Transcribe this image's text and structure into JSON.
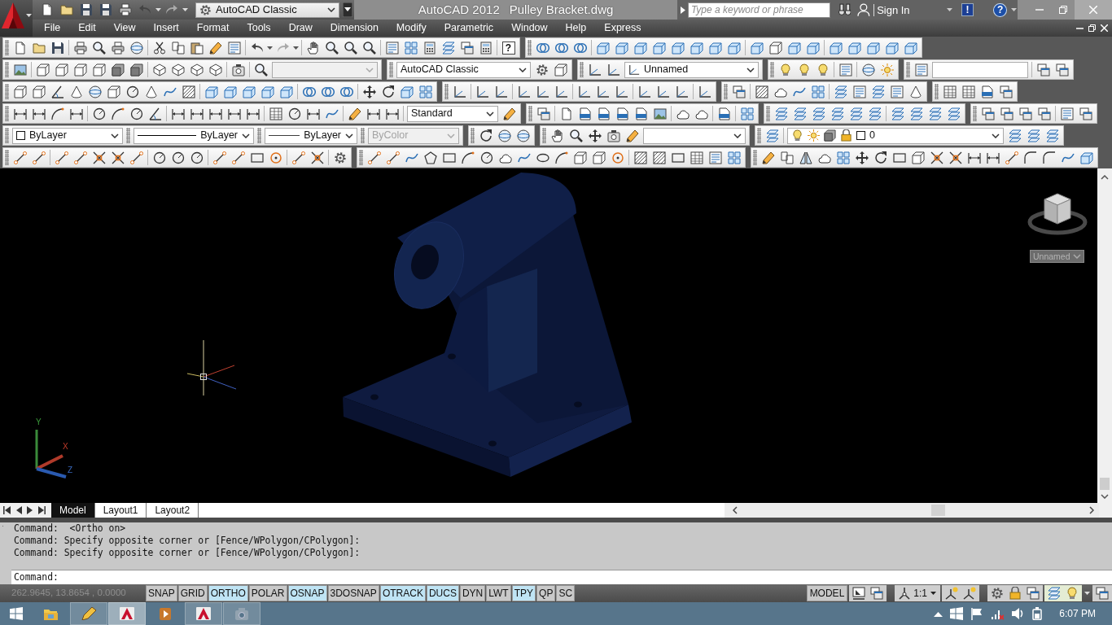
{
  "title_bar": {
    "quick_access_workspace": "AutoCAD Classic",
    "app_name": "AutoCAD 2012",
    "document": "Pulley Bracket.dwg",
    "search": {
      "placeholder": "Type a keyword or phrase"
    },
    "sign_in": "Sign In",
    "alert_glyph": "!",
    "help_glyph": "?"
  },
  "menu_bar": [
    "File",
    "Edit",
    "View",
    "Insert",
    "Format",
    "Tools",
    "Draw",
    "Dimension",
    "Modify",
    "Parametric",
    "Window",
    "Help",
    "Express"
  ],
  "toolbars": {
    "help_glyph": "?",
    "named_view": {
      "disabled": true
    },
    "workspace": "AutoCAD Classic",
    "ucs_name": "Unnamed",
    "dimension_style": "Standard",
    "object_color": "ByLayer",
    "linetype": "ByLayer",
    "lineweight": "ByLayer",
    "plot_style": {
      "value": "ByColor",
      "disabled": true
    },
    "layer": "0"
  },
  "viewport": {
    "view_name": "Unnamed",
    "ucs_axes": [
      "Y",
      "X",
      "Z"
    ]
  },
  "layout_tabs": [
    {
      "label": "Model",
      "selected": true
    },
    {
      "label": "Layout1",
      "selected": false
    },
    {
      "label": "Layout2",
      "selected": false
    }
  ],
  "command_window": {
    "history": [
      "Command:  <Ortho on>",
      "Command: Specify opposite corner or [Fence/WPolygon/CPolygon]:",
      "Command: Specify opposite corner or [Fence/WPolygon/CPolygon]:"
    ],
    "prompt": "Command:"
  },
  "status_bar": {
    "coordinates": {
      "text": "262.9645, 13.8654 , 0.0000",
      "disabled": true
    },
    "toggles": [
      {
        "label": "SNAP",
        "on": false
      },
      {
        "label": "GRID",
        "on": false
      },
      {
        "label": "ORTHO",
        "on": true
      },
      {
        "label": "POLAR",
        "on": false
      },
      {
        "label": "OSNAP",
        "on": true
      },
      {
        "label": "3DOSNAP",
        "on": false
      },
      {
        "label": "OTRACK",
        "on": true
      },
      {
        "label": "DUCS",
        "on": true
      },
      {
        "label": "DYN",
        "on": false
      },
      {
        "label": "LWT",
        "on": false
      },
      {
        "label": "TPY",
        "on": true
      },
      {
        "label": "QP",
        "on": false
      },
      {
        "label": "SC",
        "on": false
      }
    ],
    "space": "MODEL",
    "annotation_scale": "1:1"
  },
  "taskbar": {
    "apps": [
      {
        "kind": "explorer",
        "running": false,
        "selected": false
      },
      {
        "kind": "pen",
        "running": true,
        "selected": false
      },
      {
        "kind": "autocad",
        "running": true,
        "selected": true
      },
      {
        "kind": "media",
        "running": false,
        "selected": false
      },
      {
        "kind": "autocad",
        "running": true,
        "selected": false
      },
      {
        "kind": "camera",
        "running": true,
        "selected": false
      }
    ],
    "time": "6:07 PM"
  }
}
